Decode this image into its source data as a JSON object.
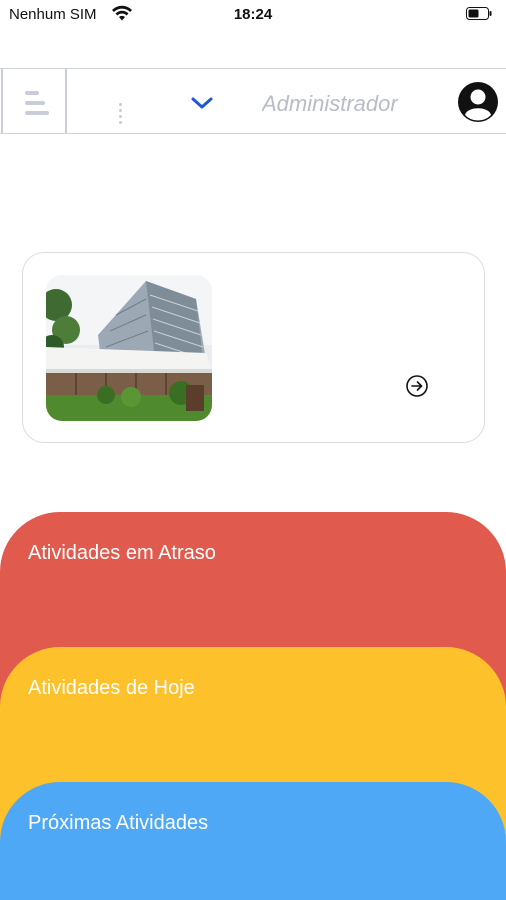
{
  "status_bar": {
    "carrier": "Nenhum SIM",
    "time": "18:24"
  },
  "header": {
    "role": "Administrador"
  },
  "panels": [
    {
      "label": "Atividades em Atraso",
      "color": "#e05a4e"
    },
    {
      "label": "Atividades de Hoje",
      "color": "#fdc12b"
    },
    {
      "label": "Próximas Atividades",
      "color": "#4fa8f6"
    }
  ],
  "icons": [
    "wifi-icon",
    "battery-icon",
    "menu-icon",
    "kebab-icon",
    "chevron-down-icon",
    "avatar-icon",
    "arrow-right-circle-icon"
  ]
}
